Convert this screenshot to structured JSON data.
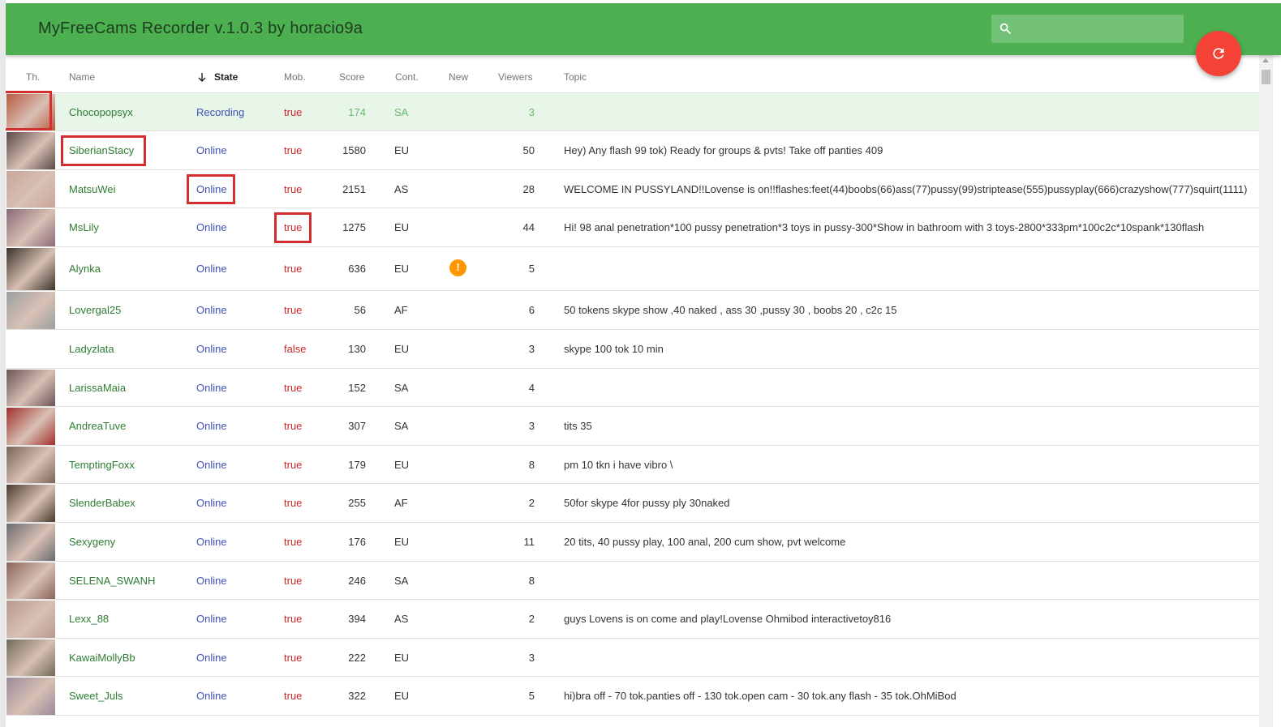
{
  "app": {
    "title": "MyFreeCams Recorder v.1.0.3 by horacio9a",
    "search_placeholder": "",
    "accent": "#4caf50",
    "fab_color": "#f44336"
  },
  "columns": {
    "thumb": "Th.",
    "name": "Name",
    "state": "State",
    "mob": "Mob.",
    "score": "Score",
    "cont": "Cont.",
    "new": "New",
    "viewers": "Viewers",
    "topic": "Topic"
  },
  "rows": [
    {
      "thumb": "#b85a40",
      "name": "Chocopopsyx",
      "state": "Recording",
      "mob": "true",
      "score": "174",
      "cont": "SA",
      "new": "",
      "viewers": "3",
      "topic": ""
    },
    {
      "thumb": "#5a4a48",
      "name": "SiberianStacy",
      "state": "Online",
      "mob": "true",
      "score": "1580",
      "cont": "EU",
      "new": "",
      "viewers": "50",
      "topic": "Hey) Any flash 99 tok) Ready for groups & pvts! Take off panties 409"
    },
    {
      "thumb": "#c9a79a",
      "name": "MatsuWei",
      "state": "Online",
      "mob": "true",
      "score": "2151",
      "cont": "AS",
      "new": "",
      "viewers": "28",
      "topic": "WELCOME IN PUSSYLAND!!Lovense is on!!flashes:feet(44)boobs(66)ass(77)pussy(99)striptease(555)pussyplay(666)crazyshow(777)squirt(1111)"
    },
    {
      "thumb": "#8a6a78",
      "name": "MsLily",
      "state": "Online",
      "mob": "true",
      "score": "1275",
      "cont": "EU",
      "new": "",
      "viewers": "44",
      "topic": "Hi! 98 anal penetration*100 pussy penetration*3 toys in pussy-300*Show in bathroom with 3 toys-2800*333pm*100c2c*10spank*130flash"
    },
    {
      "thumb": "#3a3228",
      "name": "Alynka",
      "state": "Online",
      "mob": "true",
      "score": "636",
      "cont": "EU",
      "new": "!",
      "viewers": "5",
      "topic": ""
    },
    {
      "thumb": "#9aa0a0",
      "name": "Lovergal25",
      "state": "Online",
      "mob": "true",
      "score": "56",
      "cont": "AF",
      "new": "",
      "viewers": "6",
      "topic": "50 tokens skype show ,40 naked , ass 30 ,pussy 30 , boobs 20 , c2c 15"
    },
    {
      "thumb": "",
      "name": "Ladyzlata",
      "state": "Online",
      "mob": "false",
      "score": "130",
      "cont": "EU",
      "new": "",
      "viewers": "3",
      "topic": "skype 100 tok 10 min"
    },
    {
      "thumb": "#6a5458",
      "name": "LarissaMaia",
      "state": "Online",
      "mob": "true",
      "score": "152",
      "cont": "SA",
      "new": "",
      "viewers": "4",
      "topic": ""
    },
    {
      "thumb": "#a0302a",
      "name": "AndreaTuve",
      "state": "Online",
      "mob": "true",
      "score": "307",
      "cont": "SA",
      "new": "",
      "viewers": "3",
      "topic": "tits 35"
    },
    {
      "thumb": "#7a6458",
      "name": "TemptingFoxx",
      "state": "Online",
      "mob": "true",
      "score": "179",
      "cont": "EU",
      "new": "",
      "viewers": "8",
      "topic": "pm 10 tkn i have vibro \\"
    },
    {
      "thumb": "#4a3a30",
      "name": "SlenderBabex",
      "state": "Online",
      "mob": "true",
      "score": "255",
      "cont": "AF",
      "new": "",
      "viewers": "2",
      "topic": "50for skype 4for pussy ply 30naked"
    },
    {
      "thumb": "#6a6a70",
      "name": "Sexygeny",
      "state": "Online",
      "mob": "true",
      "score": "176",
      "cont": "EU",
      "new": "",
      "viewers": "11",
      "topic": "20 tits, 40 pussy play, 100 anal, 200 cum show, pvt welcome"
    },
    {
      "thumb": "#8a6458",
      "name": "SELENA_SWANH",
      "state": "Online",
      "mob": "true",
      "score": "246",
      "cont": "SA",
      "new": "",
      "viewers": "8",
      "topic": ""
    },
    {
      "thumb": "#b89a90",
      "name": "Lexx_88",
      "state": "Online",
      "mob": "true",
      "score": "394",
      "cont": "AS",
      "new": "",
      "viewers": "2",
      "topic": "guys Lovens is on come and play!Lovense Ohmibod interactivetoy816"
    },
    {
      "thumb": "#706a5a",
      "name": "KawaiMollyBb",
      "state": "Online",
      "mob": "true",
      "score": "222",
      "cont": "EU",
      "new": "",
      "viewers": "3",
      "topic": ""
    },
    {
      "thumb": "#9a8a9a",
      "name": "Sweet_Juls",
      "state": "Online",
      "mob": "true",
      "score": "322",
      "cont": "EU",
      "new": "",
      "viewers": "5",
      "topic": "hi)bra off - 70 tok.panties off - 130 tok.open cam - 30 tok.any flash - 35 tok.OhMiBod"
    }
  ]
}
